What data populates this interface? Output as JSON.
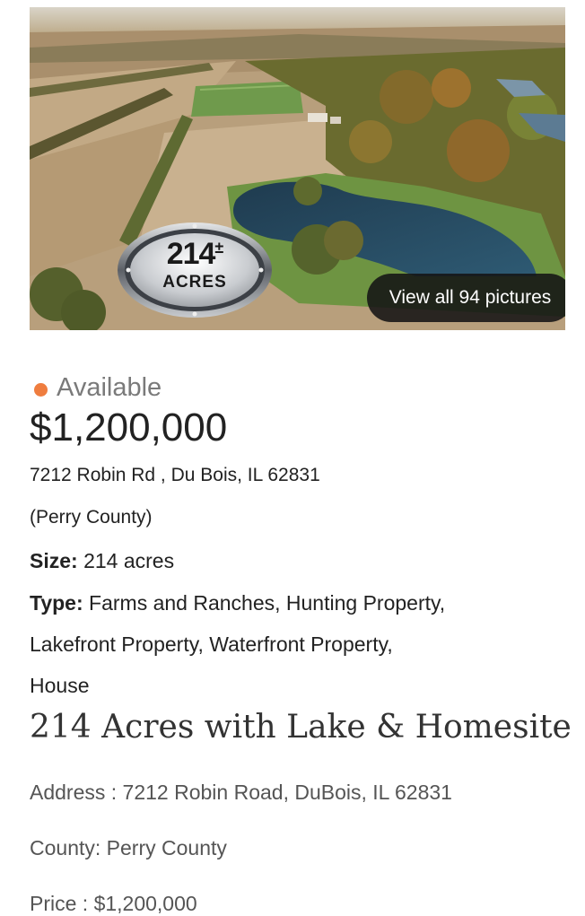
{
  "gallery": {
    "badge_number": "214",
    "badge_plusminus": "±",
    "badge_label": "ACRES",
    "view_all_label": "View all 94 pictures"
  },
  "listing": {
    "status": "Available",
    "status_color": "#ef7d3f",
    "price": "$1,200,000",
    "address": "7212 Robin Rd , Du Bois, IL 62831",
    "county": "(Perry County)",
    "size_label": "Size:",
    "size_value": "214 acres",
    "type_label": "Type:",
    "type_value_1": "Farms and Ranches, Hunting Property,",
    "type_value_2": "Lakefront Property, Waterfront Property,",
    "type_value_3": "House",
    "title": "214 Acres with Lake & Homesite"
  },
  "details": {
    "address": "Address : 7212 Robin Road, DuBois, IL 62831",
    "county": "County: Perry County",
    "price": "Price : $1,200,000"
  }
}
